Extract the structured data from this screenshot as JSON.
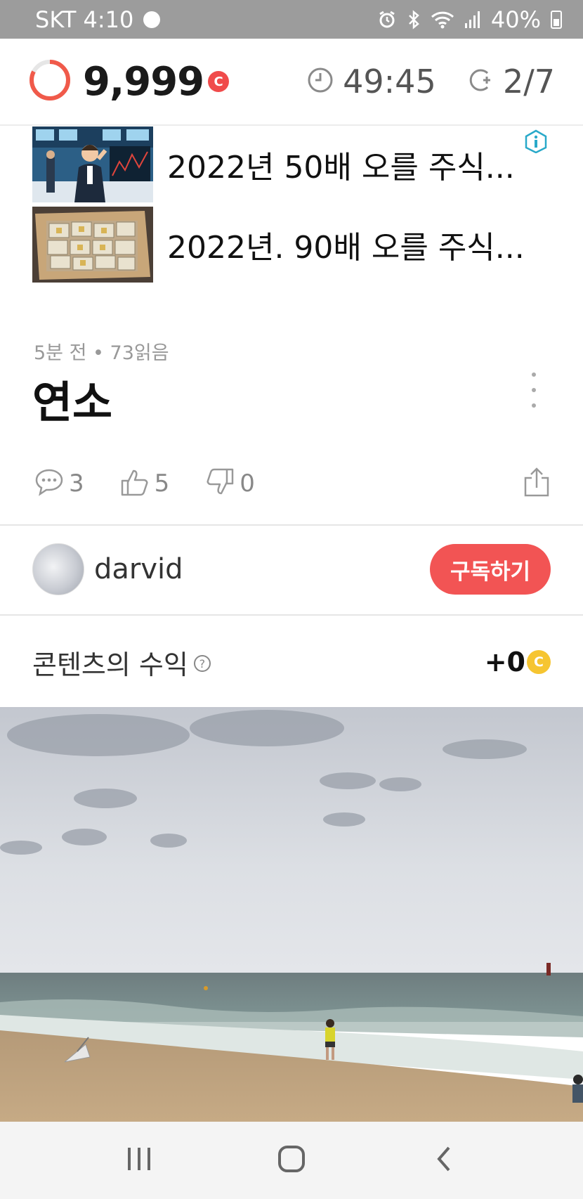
{
  "status_bar": {
    "carrier_time": "SKT 4:10",
    "battery": "40%",
    "icons": [
      "chat-bubble-icon",
      "alarm-icon",
      "bluetooth-icon",
      "wifi-icon",
      "signal-icon",
      "battery-icon"
    ]
  },
  "header": {
    "points": "9,999",
    "coin_label": "C",
    "timer": "49:45",
    "count": "2/7",
    "colors": {
      "ring": "#f05a4a",
      "coin": "#f04b4b"
    }
  },
  "ads": {
    "items": [
      {
        "title": "2022년 50배 오를 주식..."
      },
      {
        "title": "2022년. 90배 오를 주식..."
      }
    ],
    "badge_icon": "ad-info-icon",
    "badge_color": "#29a9c9"
  },
  "post": {
    "meta": "5분 전 • 73읽음",
    "title": "연소",
    "reactions": {
      "comments": "3",
      "likes": "5",
      "dislikes": "0"
    }
  },
  "author": {
    "name": "darvid",
    "subscribe_label": "구독하기",
    "subscribe_color": "#f25454"
  },
  "earnings": {
    "label": "콘텐츠의 수익",
    "help": "?",
    "value": "+0",
    "coin_label": "C",
    "coin_color": "#f6c531"
  },
  "nav": {
    "icons": [
      "recent-apps-icon",
      "home-icon",
      "back-icon"
    ]
  }
}
